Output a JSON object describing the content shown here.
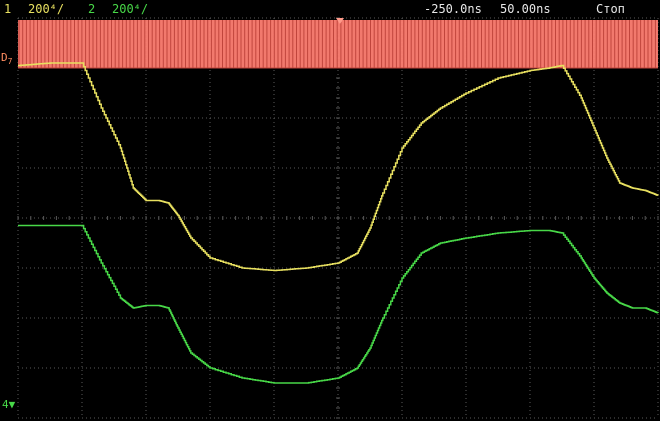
{
  "status": {
    "ch1_number": "1",
    "ch1_scale": "200⁴/",
    "ch2_number": "2",
    "ch2_scale": "200⁴/",
    "time_offset": "-250.0ns",
    "time_scale": "50.00ns",
    "run_state": "Стоп"
  },
  "digital": {
    "label": "D",
    "index": "7",
    "color": "#ff7f73"
  },
  "colors": {
    "ch1": "#e8e060",
    "ch2": "#48d848",
    "grid": "#5a5a5a",
    "status_text": "#e8e8e8"
  },
  "ground_marker": "4",
  "chart_data": {
    "type": "line",
    "title": "",
    "xlabel": "",
    "ylabel": "",
    "x_divisions": 10,
    "y_divisions": 8,
    "grid": true,
    "series": [
      {
        "name": "1",
        "color": "#e8e060",
        "x": [
          0,
          0.5,
          1.0,
          1.3,
          1.6,
          1.8,
          2.0,
          2.2,
          2.35,
          2.5,
          2.7,
          3.0,
          3.5,
          4.0,
          4.5,
          5.0,
          5.3,
          5.5,
          5.7,
          6.0,
          6.3,
          6.6,
          7.0,
          7.5,
          8.0,
          8.3,
          8.5,
          8.8,
          9.0,
          9.2,
          9.4,
          9.6,
          9.8,
          10.0
        ],
        "y": [
          3.05,
          3.1,
          3.1,
          2.2,
          1.4,
          0.6,
          0.35,
          0.35,
          0.3,
          0.05,
          -0.4,
          -0.8,
          -1.0,
          -1.05,
          -1.0,
          -0.9,
          -0.7,
          -0.2,
          0.5,
          1.4,
          1.9,
          2.2,
          2.5,
          2.8,
          2.95,
          3.0,
          3.05,
          2.4,
          1.8,
          1.2,
          0.7,
          0.6,
          0.55,
          0.45
        ]
      },
      {
        "name": "2",
        "color": "#48d848",
        "x": [
          0,
          0.5,
          1.0,
          1.3,
          1.6,
          1.8,
          2.0,
          2.2,
          2.35,
          2.5,
          2.7,
          3.0,
          3.5,
          4.0,
          4.5,
          5.0,
          5.3,
          5.5,
          5.7,
          6.0,
          6.3,
          6.6,
          7.0,
          7.5,
          8.0,
          8.3,
          8.5,
          8.8,
          9.0,
          9.2,
          9.4,
          9.6,
          9.8,
          10.0
        ],
        "y": [
          -0.15,
          -0.15,
          -0.15,
          -0.9,
          -1.6,
          -1.8,
          -1.75,
          -1.75,
          -1.8,
          -2.2,
          -2.7,
          -3.0,
          -3.2,
          -3.3,
          -3.3,
          -3.2,
          -3.0,
          -2.6,
          -2.0,
          -1.2,
          -0.7,
          -0.5,
          -0.4,
          -0.3,
          -0.25,
          -0.25,
          -0.3,
          -0.8,
          -1.2,
          -1.5,
          -1.7,
          -1.8,
          -1.8,
          -1.9
        ]
      }
    ],
    "xlim": [
      0,
      10
    ],
    "ylim": [
      -4,
      4
    ]
  }
}
